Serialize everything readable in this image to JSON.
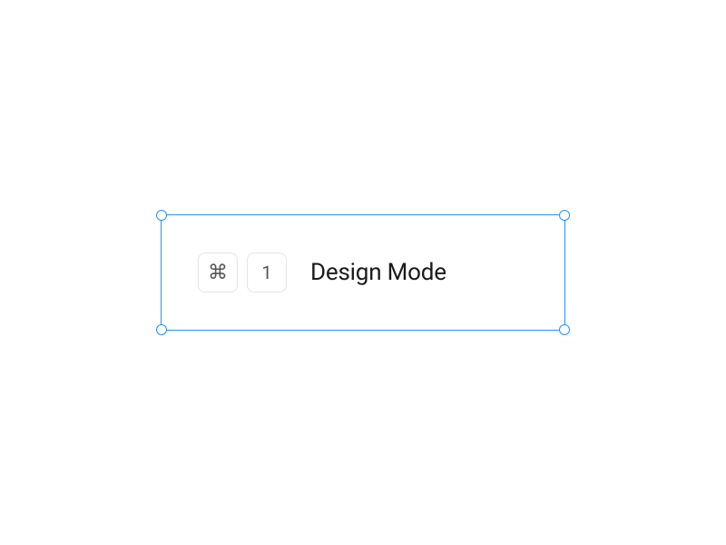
{
  "shortcut": {
    "modifier_symbol": "⌘",
    "key": "1",
    "label": "Design Mode"
  },
  "selection": {
    "color": "#2196F3"
  }
}
